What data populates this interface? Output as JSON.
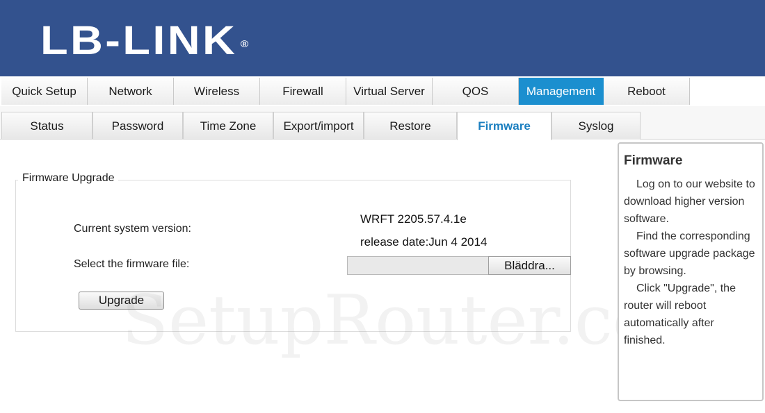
{
  "header": {
    "logo_text": "LB-LINK",
    "logo_mark": "®",
    "bg_color": "#33528e"
  },
  "main_nav": {
    "active": "Management",
    "items": [
      "Quick Setup",
      "Network",
      "Wireless",
      "Firewall",
      "Virtual Server",
      "QOS",
      "Management",
      "Reboot"
    ]
  },
  "sub_nav": {
    "active": "Firmware",
    "items": [
      "Status",
      "Password",
      "Time Zone",
      "Export/import",
      "Restore",
      "Firmware",
      "Syslog"
    ]
  },
  "firmware": {
    "legend": "Firmware Upgrade",
    "current_version_label": "Current system version:",
    "version": "WRFT 2205.57.4.1e",
    "release_date": "release date:Jun 4 2014",
    "select_file_label": "Select the firmware file:",
    "browse_label": "Bläddra...",
    "upgrade_label": "Upgrade"
  },
  "help": {
    "title": "Firmware",
    "paragraphs": [
      "Log on to our website to download higher version software.",
      "Find the corresponding software upgrade package by browsing.",
      "Click \"Upgrade\", the router will reboot automatically after finished."
    ]
  },
  "watermark": "SetupRouter.com",
  "colors": {
    "accent": "#1b8fcf",
    "active_subtab_text": "#1b7fc0"
  }
}
